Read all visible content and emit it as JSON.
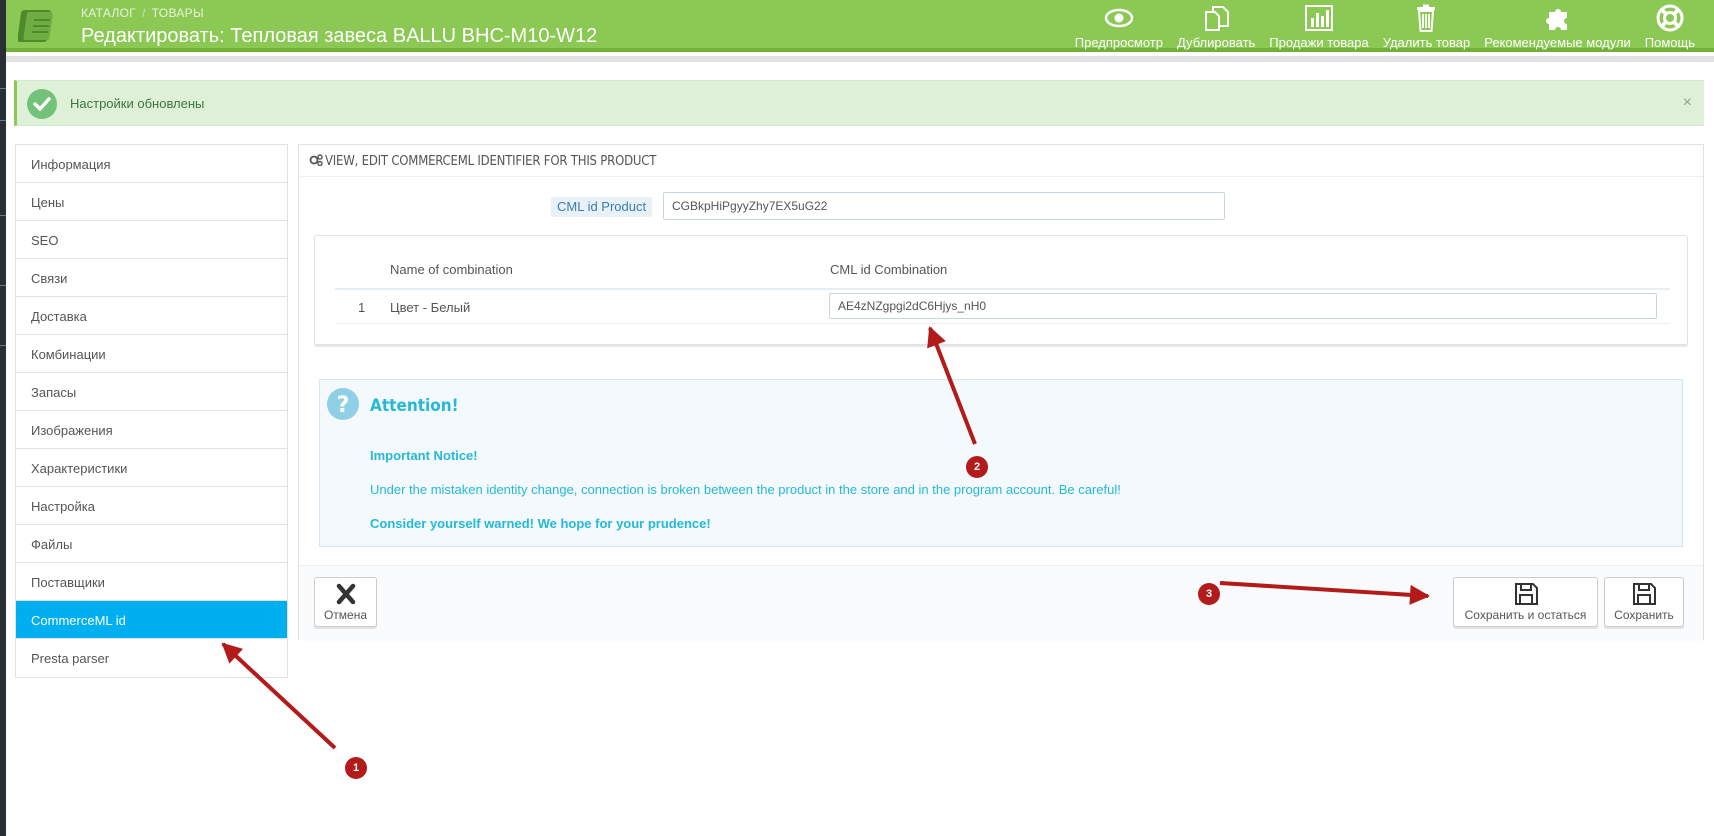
{
  "header": {
    "breadcrumb": [
      "КАТАЛОГ",
      "ТОВАРЫ"
    ],
    "title": "Редактировать: Тепловая завеса BALLU BHC-M10-W12",
    "toolbar": [
      {
        "label": "Предпросмотр",
        "icon": "eye-icon"
      },
      {
        "label": "Дублировать",
        "icon": "copy-icon"
      },
      {
        "label": "Продажи товара",
        "icon": "bar-chart-icon"
      },
      {
        "label": "Удалить товар",
        "icon": "trash-icon"
      },
      {
        "label": "Рекомендуемые модули",
        "icon": "puzzle-icon"
      },
      {
        "label": "Помощь",
        "icon": "lifebuoy-icon"
      }
    ]
  },
  "alert": {
    "text": "Настройки обновлены",
    "close": "×"
  },
  "nav": {
    "items": [
      "Информация",
      "Цены",
      "SEO",
      "Связи",
      "Доставка",
      "Комбинации",
      "Запасы",
      "Изображения",
      "Характеристики",
      "Настройка",
      "Файлы",
      "Поставщики",
      "CommerceML id",
      "Presta parser"
    ],
    "active": "CommerceML id"
  },
  "panel": {
    "heading": "VIEW, EDIT COMMERCEML IDENTIFIER FOR THIS PRODUCT",
    "cml_label": "CML id Product",
    "cml_value": "CGBkpHiPgyyZhy7EX5uG22",
    "combo_table": {
      "headers": [
        "Name of combination",
        "CML id Combination"
      ],
      "rows": [
        {
          "num": "1",
          "name": "Цвет - Белый",
          "cml_id": "AE4zNZgpgi2dC6Hjys_nH0"
        }
      ]
    },
    "attention": {
      "title": "Attention!",
      "notice": "Important Notice!",
      "body": "Under the mistaken identity change, connection is broken between the product in the store and in the program account. Be careful!",
      "warning": "Consider yourself warned! We hope for your prudence!"
    },
    "footer": {
      "cancel": "Отмена",
      "save_stay": "Сохранить и остаться",
      "save": "Сохранить"
    }
  },
  "annotations": [
    "1",
    "2",
    "3"
  ]
}
